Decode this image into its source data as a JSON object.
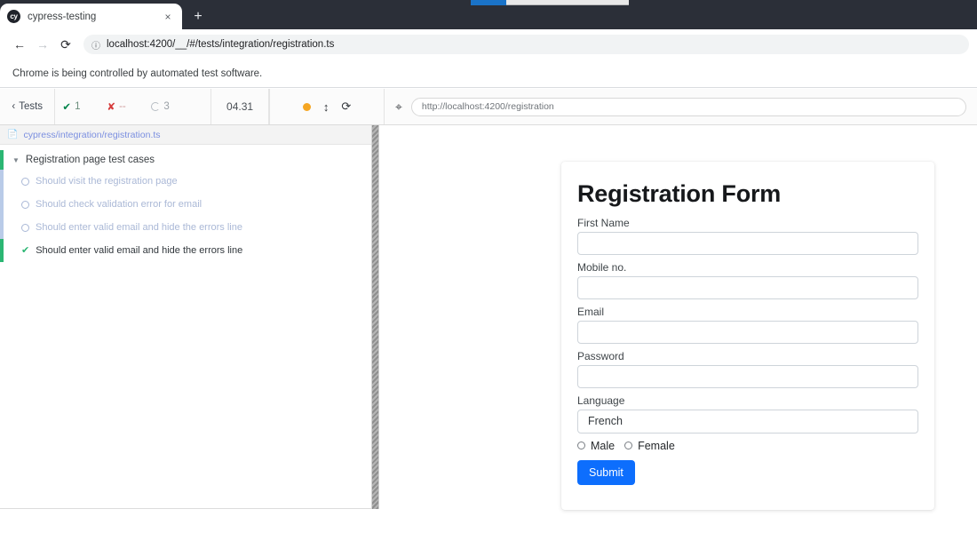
{
  "browser": {
    "tab": {
      "title": "cypress-testing",
      "favicon_text": "cy",
      "close_label": "×"
    },
    "new_tab_label": "+",
    "nav": {
      "back_icon": "←",
      "forward_icon": "→",
      "reload_icon": "⟳",
      "info_icon": "ⓘ",
      "url": "localhost:4200/__/#/tests/integration/registration.ts"
    },
    "infobar_text": "Chrome is being controlled by automated test software."
  },
  "runner": {
    "back_label": "Tests",
    "back_icon": "‹",
    "stats": {
      "passed_icon": "✔",
      "passed_count": "1",
      "failed_icon": "✘",
      "failed_count": "--",
      "pending_count": "3"
    },
    "timer": "04.31",
    "controls": {
      "viewport_icon": "↕",
      "restart_icon": "⟳"
    },
    "selector_icon": "⌖",
    "app_url": "http://localhost:4200/registration"
  },
  "specs": {
    "file_path": "cypress/integration/registration.ts",
    "suite": {
      "title": "Registration page test cases",
      "caret": "▼"
    },
    "tests": [
      {
        "label": "Should visit the registration page",
        "state": "pending"
      },
      {
        "label": "Should check validation error for email",
        "state": "pending"
      },
      {
        "label": "Should enter valid email and hide the errors line",
        "state": "pending"
      },
      {
        "label": "Should enter valid email and hide the errors line",
        "state": "passed"
      }
    ],
    "pass_icon": "✔"
  },
  "form": {
    "title": "Registration Form",
    "fields": [
      {
        "label": "First Name",
        "value": "",
        "type": "text"
      },
      {
        "label": "Mobile no.",
        "value": "",
        "type": "text"
      },
      {
        "label": "Email",
        "value": "",
        "type": "text"
      },
      {
        "label": "Password",
        "value": "",
        "type": "text"
      }
    ],
    "language": {
      "label": "Language",
      "value": "French"
    },
    "gender": [
      {
        "label": "Male",
        "selected": false
      },
      {
        "label": "Female",
        "selected": false
      }
    ],
    "submit_label": "Submit"
  },
  "colors": {
    "accent_blue": "#0d6efd",
    "pass_green": "#2bb673",
    "fail_red": "#d63b3b",
    "pending_blue": "#aab8d6",
    "titlebar": "#2b2f38",
    "orange_dot": "#f5a623"
  }
}
